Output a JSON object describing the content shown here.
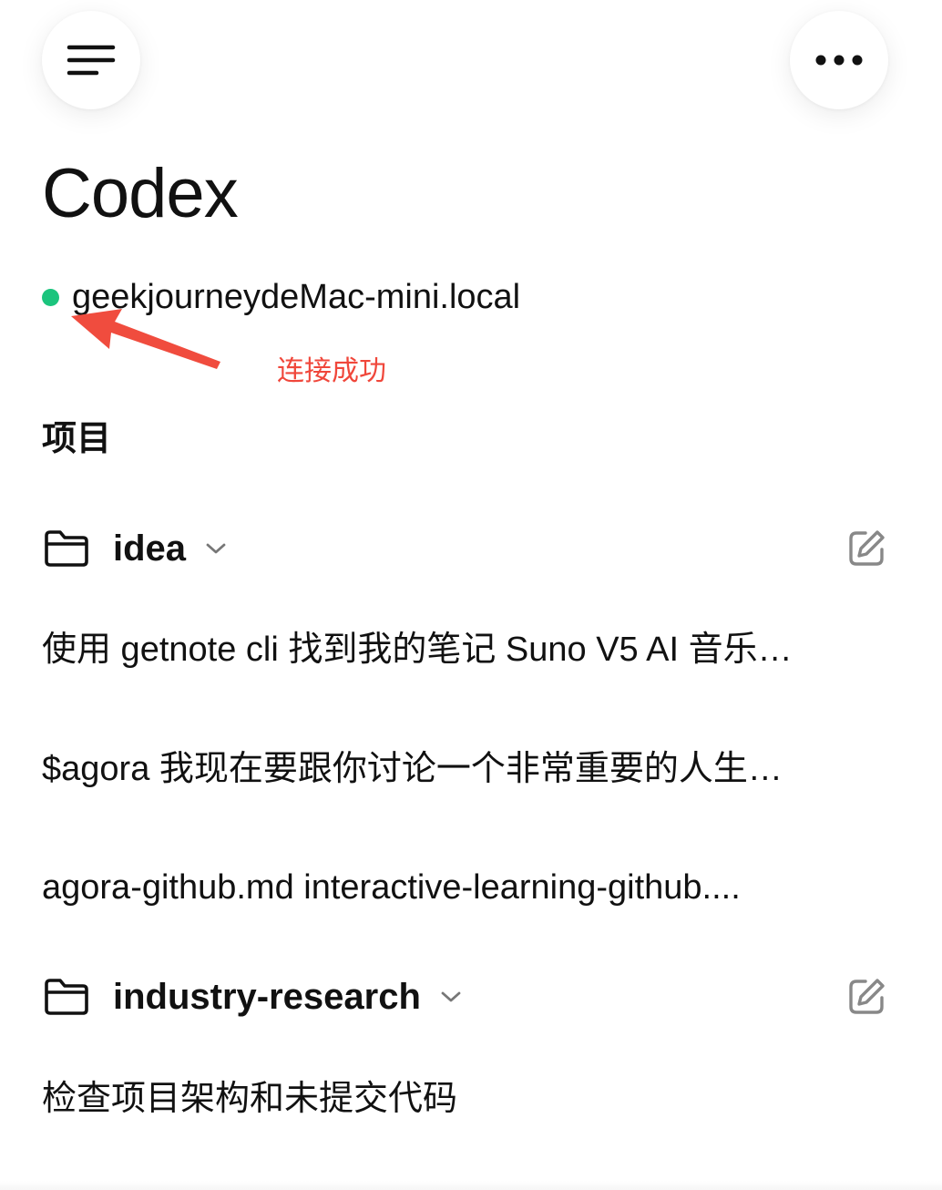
{
  "header": {
    "menu_icon": "hamburger-menu-icon",
    "more_icon": "more-horizontal-icon",
    "title": "Codex"
  },
  "connection": {
    "status_color": "#1bc47d",
    "host": "geekjourneydeMac-mini.local",
    "annotation": "连接成功",
    "annotation_color": "#f0473b"
  },
  "projects_section": {
    "heading": "项目",
    "projects": [
      {
        "name": "idea",
        "folder_icon": "folder-icon",
        "expand_icon": "chevron-down-icon",
        "new_thread_icon": "edit-icon",
        "threads": [
          "使用 getnote cli 找到我的笔记 Suno V5 AI 音乐…",
          "$agora 我现在要跟你讨论一个非常重要的人生…",
          "agora-github.md interactive-learning-github...."
        ]
      },
      {
        "name": "industry-research",
        "folder_icon": "folder-icon",
        "expand_icon": "chevron-down-icon",
        "new_thread_icon": "edit-icon",
        "threads": [
          "检查项目架构和未提交代码"
        ]
      }
    ]
  }
}
